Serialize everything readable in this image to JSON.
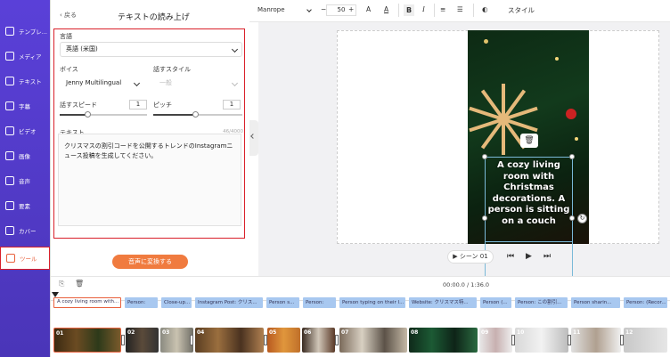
{
  "rail": {
    "items": [
      {
        "label": "テンプレ...",
        "icon": "layers-icon"
      },
      {
        "label": "メディア",
        "icon": "media-icon"
      },
      {
        "label": "テキスト",
        "icon": "text-icon"
      },
      {
        "label": "字幕",
        "icon": "subtitle-icon"
      },
      {
        "label": "ビデオ",
        "icon": "video-icon"
      },
      {
        "label": "画像",
        "icon": "image-icon"
      },
      {
        "label": "音声",
        "icon": "audio-icon"
      },
      {
        "label": "要素",
        "icon": "elements-icon"
      },
      {
        "label": "カバー",
        "icon": "cover-icon"
      },
      {
        "label": "ツール",
        "icon": "tools-icon"
      }
    ]
  },
  "panel": {
    "back_label": "‹ 戻る",
    "title": "テキストの読み上げ",
    "language_label": "言語",
    "language_value": "英語 (米国)",
    "voice_label": "ボイス",
    "voice_value": "Jenny Multilingual",
    "style_label": "話すスタイル",
    "style_value": "一般",
    "speed_label": "話すスピード",
    "speed_value": "1",
    "pitch_label": "ピッチ",
    "pitch_value": "1",
    "text_label": "テキスト",
    "char_count": "46/4000",
    "text_value": "クリスマスの割引コードを公開するトレンドのInstagramニュース投稿を生成してください。",
    "convert_button": "音声に変換する"
  },
  "toolbar": {
    "font": "Manrope",
    "size": "50",
    "minus": "−",
    "plus": "+",
    "bold": "B",
    "italic": "I",
    "style_label": "スタイル"
  },
  "canvas": {
    "caption": "A cozy living room with Christmas decorations. A person is sitting on a couch",
    "scene_label": "▶ シーン 01"
  },
  "timeline": {
    "time": "00:00.0 / 1:36.0",
    "segments": [
      "A cozy living room with...",
      "Person:",
      "Close-up...",
      "Instagram Post: クリス...",
      "Person s...",
      "Person:",
      "Person typing on their l...",
      "Website: クリスマス特...",
      "Person (...",
      "Person: この割引...",
      "Person sharin...",
      "Person: (Recor..."
    ],
    "thumbs": [
      "01",
      "02",
      "03",
      "04",
      "05",
      "06",
      "07",
      "08",
      "09",
      "10",
      "11",
      "12"
    ]
  }
}
